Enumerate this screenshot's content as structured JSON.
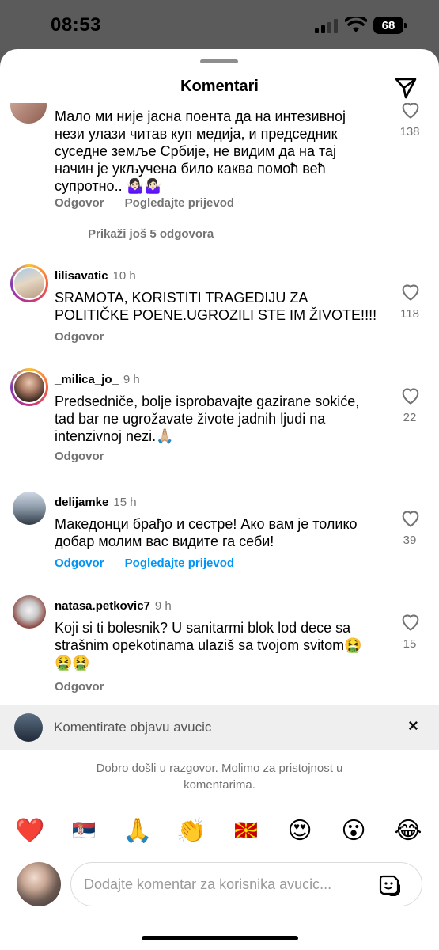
{
  "status": {
    "time": "08:53",
    "battery": "68"
  },
  "header": {
    "title": "Komentari"
  },
  "comments": [
    {
      "username": "",
      "ago": "",
      "lines": [
        "Мало ми није јасна поента да на интезивној",
        "нези улази читав куп медија, и  председник",
        "суседне земље Србије, не видим да на тај",
        "начин је укључена било каква помоћ већ",
        "супротно.. 🤷🏻‍♀️🤷🏻‍♀️"
      ],
      "reply": "Odgovor",
      "translate": "Pogledajte prijevod",
      "likes": "138",
      "more": "Prikaži još 5 odgovora"
    },
    {
      "username": "lilisavatic",
      "ago": "10 h",
      "lines": [
        "SRAMOTA,  KORISTITI TRAGEDIJU ZA",
        "POLITIČKE POENE.UGROZILI STE IM ŽIVOTE!!!!"
      ],
      "reply": "Odgovor",
      "likes": "118"
    },
    {
      "username": "_milica_jo_",
      "ago": "9 h",
      "lines": [
        "Predsedniče, bolje isprobavajte gazirane sokiće,",
        "tad bar ne ugrožavate živote jadnih ljudi na",
        "intenzivnoj nezi.🙏🏼"
      ],
      "reply": "Odgovor",
      "likes": "22"
    },
    {
      "username": "delijamke",
      "ago": "15 h",
      "lines": [
        "Македонци брађо и сестре! Ако вам је толико",
        "добар молим вас видите га себи!"
      ],
      "reply": "Odgovor",
      "translate": "Pogledajte prijevod",
      "likes": "39"
    },
    {
      "username": "natasa.petkovic7",
      "ago": "9 h",
      "lines": [
        "Koji si ti bolesnik? U sanitarmi blok lod dece sa",
        "strašnim opekotinama ulaziš sa tvojom svitom🤮",
        "🤮🤮"
      ],
      "reply": "Odgovor",
      "likes": "15"
    }
  ],
  "reply_bar": {
    "text": "Komentirate objavu avucic",
    "close": "×"
  },
  "welcome": "Dobro došli u razgovor. Molimo za pristojnost u komentarima.",
  "emojis": [
    "❤️",
    "🇷🇸",
    "🙏",
    "👏",
    "🇲🇰",
    "😍",
    "😮",
    "😂"
  ],
  "input": {
    "placeholder": "Dodajte komentar za korisnika avucic..."
  },
  "colors": {
    "link": "#0095f6",
    "muted": "#737373",
    "sheet": "#ffffff",
    "status_bg": "#5b5b5b"
  }
}
